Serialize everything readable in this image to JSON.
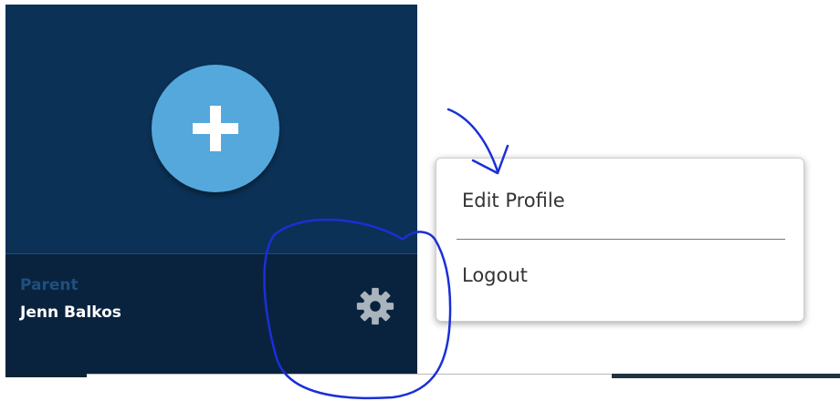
{
  "sidebar": {
    "add_button_icon": "plus-icon",
    "role_label": "Parent",
    "user_name": "Jenn Balkos",
    "settings_icon": "gear-icon"
  },
  "profile_menu": {
    "items": [
      {
        "label": "Edit Profile"
      },
      {
        "label": "Logout"
      }
    ]
  },
  "colors": {
    "sidebar_bg": "#0c3156",
    "sidebar_footer_bg": "#09233f",
    "add_button": "#55a8dc",
    "role_label": "#1f4f7f",
    "annotation_ink": "#1a2fd6"
  }
}
